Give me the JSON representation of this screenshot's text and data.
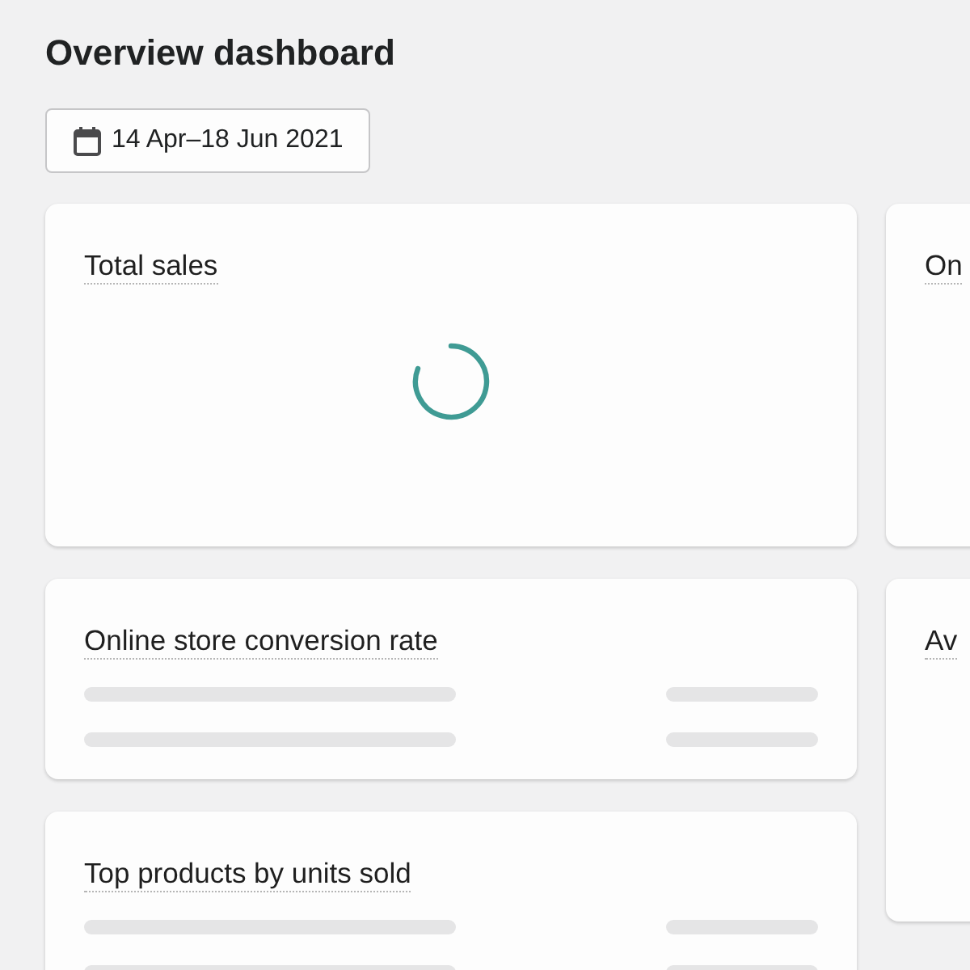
{
  "page": {
    "title": "Overview dashboard"
  },
  "date_range": {
    "label": "14 Apr–18 Jun 2021"
  },
  "columns": [
    {
      "cards": [
        {
          "title": "Total sales",
          "kind": "loading"
        },
        {
          "title": "Online store conversion rate",
          "kind": "skeleton"
        },
        {
          "title": "Top products by units sold",
          "kind": "skeleton"
        }
      ]
    },
    {
      "cards": [
        {
          "title": "On",
          "kind": "empty"
        },
        {
          "title": "Av",
          "kind": "empty"
        }
      ]
    }
  ]
}
